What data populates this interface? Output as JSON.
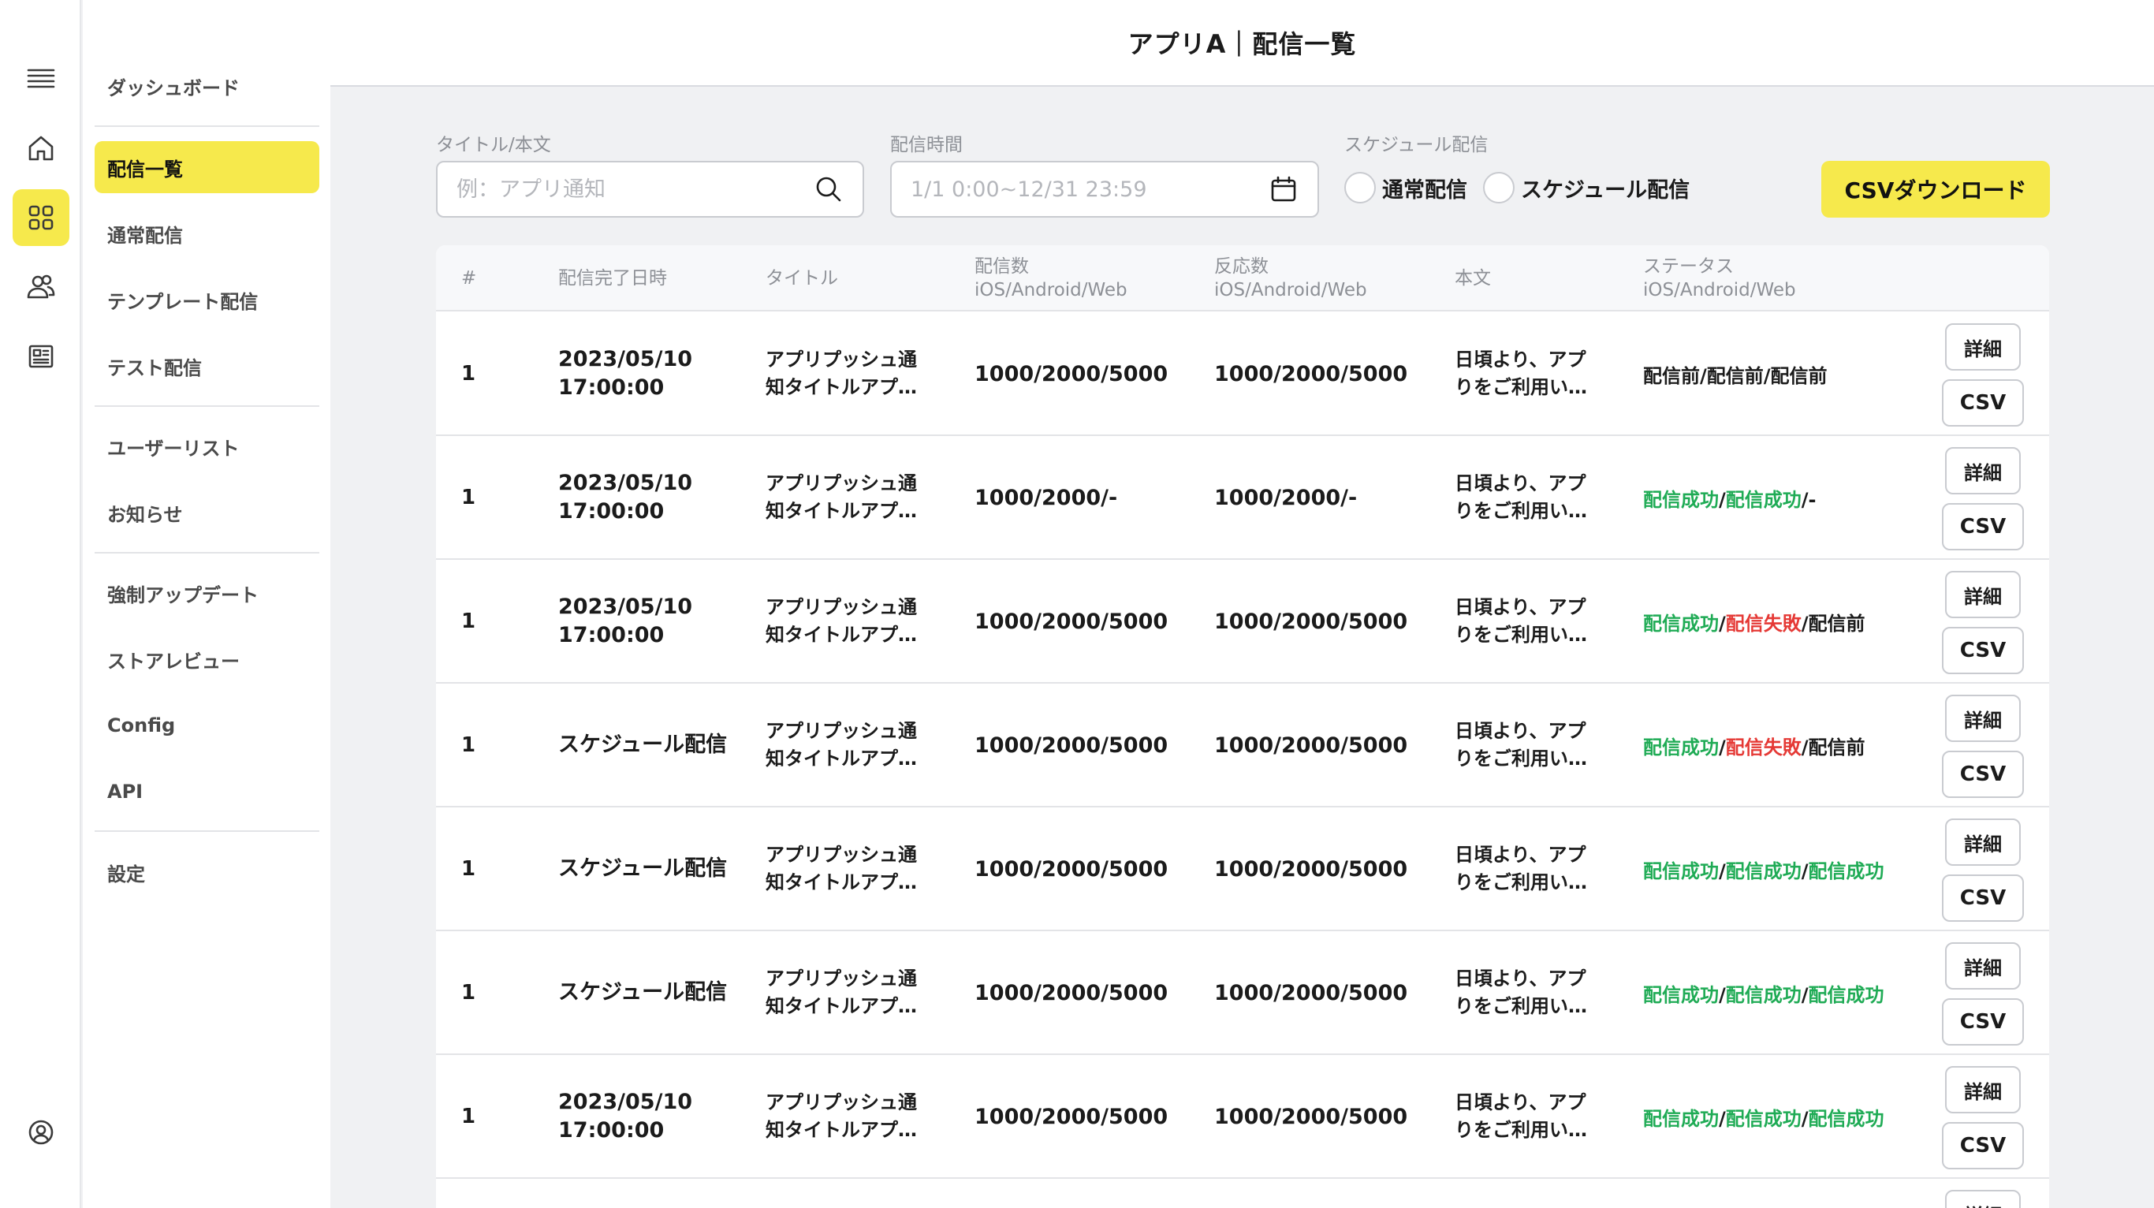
{
  "header": {
    "title": "アプリA｜配信一覧"
  },
  "rail": {
    "icons": [
      "hamburger-icon",
      "home-icon",
      "grid-icon",
      "users-icon",
      "newspaper-icon",
      "account-icon"
    ]
  },
  "menu": {
    "items": [
      {
        "label": "ダッシュボード"
      },
      {
        "label": "配信一覧"
      },
      {
        "label": "通常配信"
      },
      {
        "label": "テンプレート配信"
      },
      {
        "label": "テスト配信"
      },
      {
        "label": "ユーザーリスト"
      },
      {
        "label": "お知らせ"
      },
      {
        "label": "強制アップデート"
      },
      {
        "label": "ストアレビュー"
      },
      {
        "label": "Config"
      },
      {
        "label": "API"
      },
      {
        "label": "設定"
      }
    ]
  },
  "filters": {
    "title_label": "タイトル/本文",
    "title_placeholder": "例：アプリ通知",
    "time_label": "配信時間",
    "time_placeholder": "1/1 0:00~12/31 23:59",
    "schedule_label": "スケジュール配信",
    "radio_normal": "通常配信",
    "radio_schedule": "スケジュール配信",
    "csv_download": "CSVダウンロード"
  },
  "table": {
    "headers": {
      "num": "#",
      "date": "配信完了日時",
      "title": "タイトル",
      "sent": "配信数",
      "sent_sub": "iOS/Android/Web",
      "react": "反応数",
      "react_sub": "iOS/Android/Web",
      "body": "本文",
      "status": "ステータス",
      "status_sub": "iOS/Android/Web"
    },
    "detail_label": "詳細",
    "csv_label": "CSV",
    "rows": [
      {
        "num": "1",
        "date1": "2023/05/10",
        "date2": "17:00:00",
        "title1": "アプリプッシュ通",
        "title2": "知タイトルアプ…",
        "sent": "1000/2000/5000",
        "react": "1000/2000/5000",
        "body1": "日頃より、アプ",
        "body2": "りをご利用い…",
        "status": [
          {
            "t": "配信前",
            "c": "plain"
          },
          {
            "t": "配信前",
            "c": "plain"
          },
          {
            "t": "配信前",
            "c": "plain"
          }
        ]
      },
      {
        "num": "1",
        "date1": "2023/05/10",
        "date2": "17:00:00",
        "title1": "アプリプッシュ通",
        "title2": "知タイトルアプ…",
        "sent": "1000/2000/-",
        "react": "1000/2000/-",
        "body1": "日頃より、アプ",
        "body2": "りをご利用い…",
        "status": [
          {
            "t": "配信成功",
            "c": "ok"
          },
          {
            "t": "配信成功",
            "c": "ok"
          },
          {
            "t": "-",
            "c": "plain"
          }
        ]
      },
      {
        "num": "1",
        "date1": "2023/05/10",
        "date2": "17:00:00",
        "title1": "アプリプッシュ通",
        "title2": "知タイトルアプ…",
        "sent": "1000/2000/5000",
        "react": "1000/2000/5000",
        "body1": "日頃より、アプ",
        "body2": "りをご利用い…",
        "status": [
          {
            "t": "配信成功",
            "c": "ok"
          },
          {
            "t": "配信失敗",
            "c": "ng"
          },
          {
            "t": "配信前",
            "c": "plain"
          }
        ]
      },
      {
        "num": "1",
        "date1": "スケジュール配信",
        "date2": "",
        "title1": "アプリプッシュ通",
        "title2": "知タイトルアプ…",
        "sent": "1000/2000/5000",
        "react": "1000/2000/5000",
        "body1": "日頃より、アプ",
        "body2": "りをご利用い…",
        "status": [
          {
            "t": "配信成功",
            "c": "ok"
          },
          {
            "t": "配信失敗",
            "c": "ng"
          },
          {
            "t": "配信前",
            "c": "plain"
          }
        ]
      },
      {
        "num": "1",
        "date1": "スケジュール配信",
        "date2": "",
        "title1": "アプリプッシュ通",
        "title2": "知タイトルアプ…",
        "sent": "1000/2000/5000",
        "react": "1000/2000/5000",
        "body1": "日頃より、アプ",
        "body2": "りをご利用い…",
        "status": [
          {
            "t": "配信成功",
            "c": "ok"
          },
          {
            "t": "配信成功",
            "c": "ok"
          },
          {
            "t": "配信成功",
            "c": "ok"
          }
        ]
      },
      {
        "num": "1",
        "date1": "スケジュール配信",
        "date2": "",
        "title1": "アプリプッシュ通",
        "title2": "知タイトルアプ…",
        "sent": "1000/2000/5000",
        "react": "1000/2000/5000",
        "body1": "日頃より、アプ",
        "body2": "りをご利用い…",
        "status": [
          {
            "t": "配信成功",
            "c": "ok"
          },
          {
            "t": "配信成功",
            "c": "ok"
          },
          {
            "t": "配信成功",
            "c": "ok"
          }
        ]
      },
      {
        "num": "1",
        "date1": "2023/05/10",
        "date2": "17:00:00",
        "title1": "アプリプッシュ通",
        "title2": "知タイトルアプ…",
        "sent": "1000/2000/5000",
        "react": "1000/2000/5000",
        "body1": "日頃より、アプ",
        "body2": "りをご利用い…",
        "status": [
          {
            "t": "配信成功",
            "c": "ok"
          },
          {
            "t": "配信成功",
            "c": "ok"
          },
          {
            "t": "配信成功",
            "c": "ok"
          }
        ]
      }
    ]
  },
  "colors": {
    "accent": "#f6e94c",
    "success": "#1fab55",
    "failure": "#e53935"
  }
}
